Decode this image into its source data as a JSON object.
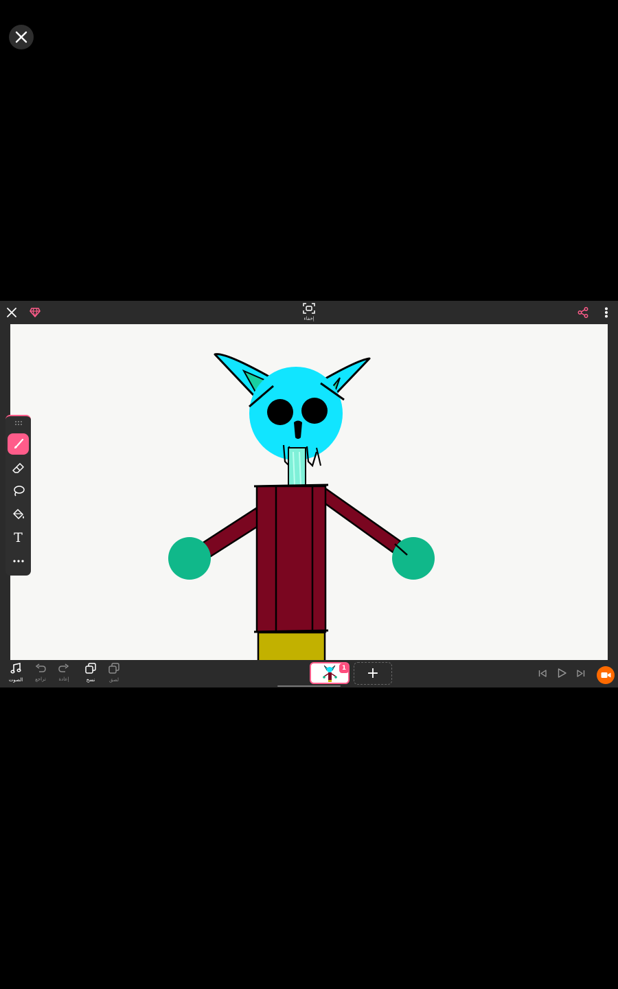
{
  "viewer": {
    "close_icon": "close-icon"
  },
  "topbar": {
    "hide_label": "إخفاء",
    "accent_color": "#ff5c8a"
  },
  "toolbox": {
    "tools": [
      "brush-icon",
      "eraser-icon",
      "lasso-icon",
      "fill-bucket-icon",
      "text-icon",
      "more-icon"
    ],
    "active": "brush-icon",
    "text_tool_glyph": "T"
  },
  "bottombar": {
    "sound_label": "الصوت",
    "undo_label": "تراجع",
    "redo_label": "إعادة",
    "copy_label": "نسخ",
    "paste_label": "لصق",
    "frame_count": "1",
    "add_frame_glyph": "+",
    "record_color": "#ff6a00"
  },
  "drawing": {
    "head_color": "#11e5ff",
    "body_color": "#7a0620",
    "hands_color": "#10b88a",
    "legs_color": "#c2b100"
  }
}
